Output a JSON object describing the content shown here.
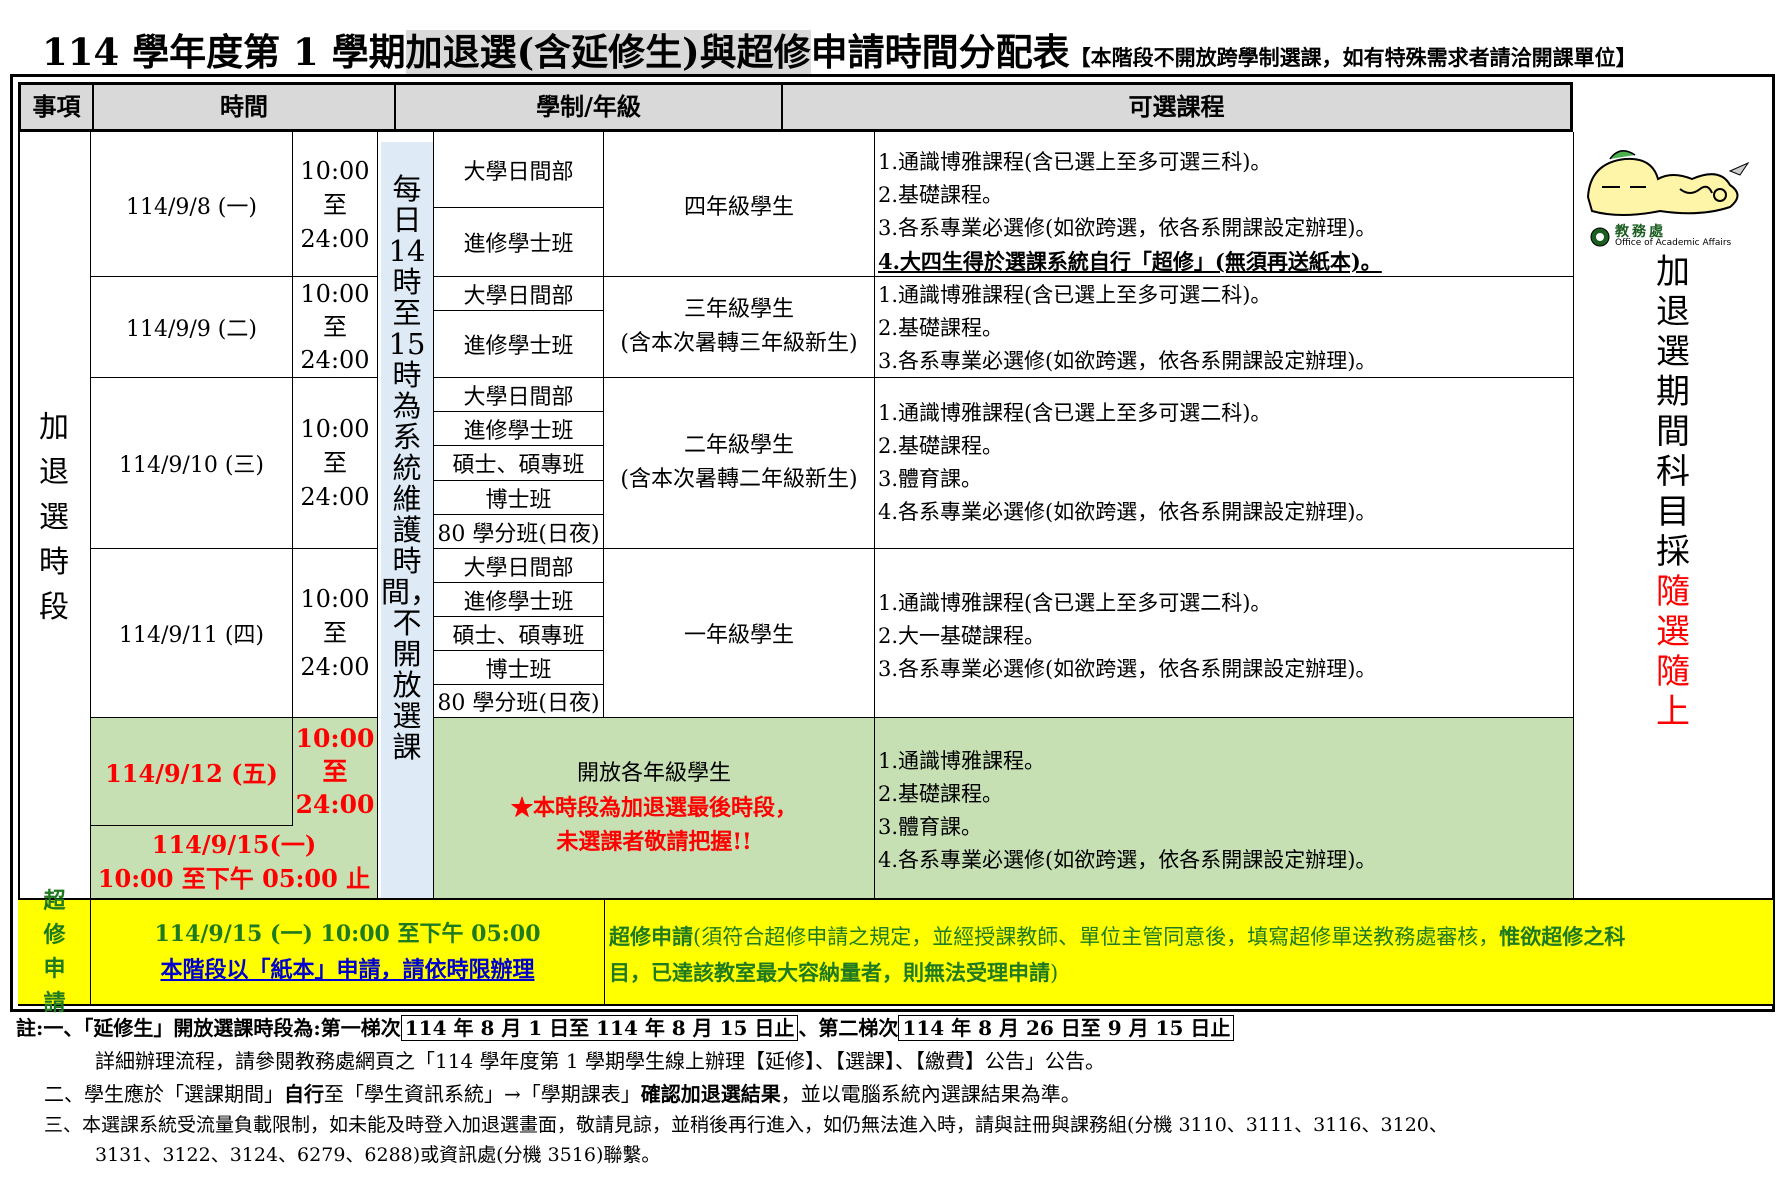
{
  "title": {
    "part1": "114 學年度第 1 學期",
    "highlight1": "加退選(含延修生)與超修",
    "part2": "申請時間分配表",
    "note": "【本階段不開放跨學制選課，如有特殊需求者請洽開課單位】"
  },
  "headers": {
    "item": "事項",
    "time": "時間",
    "program": "學制/年級",
    "courses": "可選課程"
  },
  "section_label": "加退選時段",
  "maintenance_note": "每日14時至15時為系統維護時間，不開放選課",
  "time_range": {
    "start": "10:00",
    "to": "至",
    "end": "24:00"
  },
  "rows": [
    {
      "date": "114/9/8 (一)",
      "programs": [
        "大學日間部",
        "進修學士班"
      ],
      "grade": "四年級學生",
      "courses": [
        "1.通識博雅課程(含已選上至多可選三科)。",
        "2.基礎課程。",
        "3.各系專業必選修(如欲跨選，依各系開課設定辦理)。"
      ],
      "bold_course": "4.大四生得於選課系統自行「超修」(無須再送紙本)。"
    },
    {
      "date": "114/9/9 (二)",
      "programs": [
        "大學日間部",
        "進修學士班"
      ],
      "grade": "三年級學生",
      "grade_note": "(含本次暑轉三年級新生)",
      "courses": [
        "1.通識博雅課程(含已選上至多可選二科)。",
        "2.基礎課程。",
        "3.各系專業必選修(如欲跨選，依各系開課設定辦理)。"
      ]
    },
    {
      "date": "114/9/10 (三)",
      "programs": [
        "大學日間部",
        "進修學士班",
        "碩士、碩專班",
        "博士班",
        "80 學分班(日夜)"
      ],
      "grade": "二年級學生",
      "grade_note": "(含本次暑轉二年級新生)",
      "courses": [
        "1.通識博雅課程(含已選上至多可選二科)。",
        "2.基礎課程。",
        "3.體育課。",
        "4.各系專業必選修(如欲跨選，依各系開課設定辦理)。"
      ]
    },
    {
      "date": "114/9/11 (四)",
      "programs": [
        "大學日間部",
        "進修學士班",
        "碩士、碩專班",
        "博士班",
        "80 學分班(日夜)"
      ],
      "grade": "一年級學生",
      "courses": [
        "1.通識博雅課程(含已選上至多可選二科)。",
        "2.大一基礎課程。",
        "3.各系專業必選修(如欲跨選，依各系開課設定辦理)。"
      ]
    }
  ],
  "final": {
    "date1": "114/9/12 (五)",
    "date2": "114/9/15(一)",
    "date2_time": "10:00 至下午 05:00 止",
    "grade": "開放各年級學生",
    "warn1": "★本時段為加退選最後時段，",
    "warn2": "未選課者敬請把握!!",
    "courses": [
      "1.通識博雅課程。",
      "2.基礎課程。",
      "3.體育課。",
      "4.各系專業必選修(如欲跨選，依各系開課設定辦理)。"
    ]
  },
  "logo": {
    "name": "教務處",
    "sub": "Office of Academic Affairs"
  },
  "side_note": {
    "part1": "加退選期間科目採",
    "part2": "隨選隨上"
  },
  "overload": {
    "label": "超修申請",
    "time": "114/9/15 (一) 10:00 至下午 05:00",
    "link": "本階段以「紙本」申請，請依時限辦理",
    "desc_bold": "超修申請",
    "desc": "(須符合超修申請之規定，並經授課教師、單位主管同意後，填寫超修單送教務處審核，",
    "desc_bold2": "惟欲超修之科",
    "desc_line2_bold": "目，已達該教室最大容納量者，則無法受理申請",
    "desc_line2_end": ")"
  },
  "notes": {
    "n1_prefix": "註:一、「延修生」開放選課時段為:第一梯次",
    "n1_box1": "114 年 8 月 1 日至 114 年 8 月 15 日止",
    "n1_mid": "、第二梯次",
    "n1_box2": "114 年 8 月 26 日至 9 月 15 日止",
    "n1_line2": "詳細辦理流程，請參閱教務處網頁之「114 學年度第 1 學期學生線上辦理【延修】、【選課】、【繳費】公告」公告。",
    "n2_a": "二、學生應於「選課期間」",
    "n2_b": "自行",
    "n2_c": "至「學生資訊系統」→「學期課表」",
    "n2_d": "確認加退選結果",
    "n2_e": "，並以電腦系統內選課結果為準。",
    "n3_line1": "三、本選課系統受流量負載限制，如未能及時登入加退選畫面，敬請見諒，並稍後再行進入，如仍無法進入時，請與註冊與課務組(分機 3110、3111、3116、3120、",
    "n3_line2": "3131、3122、3124、6279、6288)或資訊處(分機 3516)聯繫。"
  }
}
